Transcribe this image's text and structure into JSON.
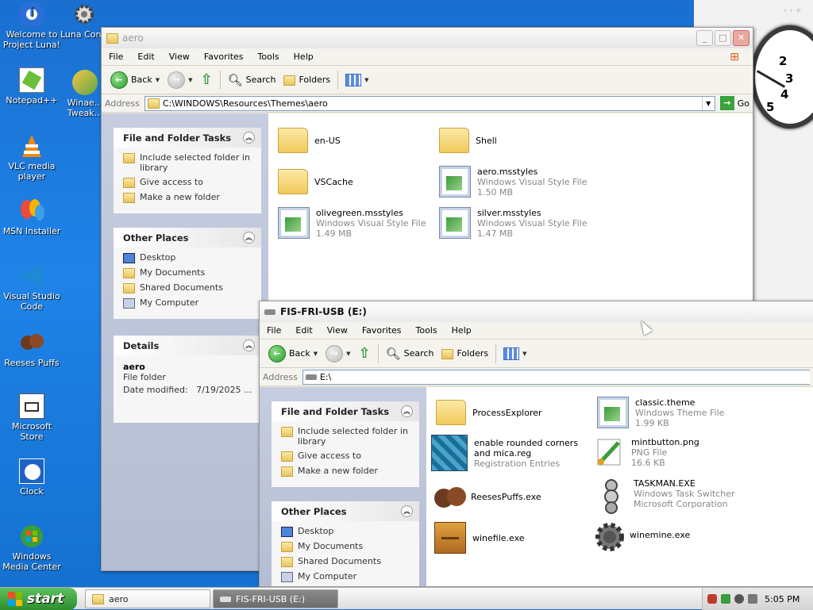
{
  "desktop": {
    "icons": [
      {
        "label": "Welcome to Project Luna!",
        "icon": "info-icon"
      },
      {
        "label": "Luna Configur...",
        "icon": "gears-icon"
      },
      {
        "label": "Notepad++",
        "icon": "notepad-icon"
      },
      {
        "label": "Winae... Tweak...",
        "icon": "winaero-icon"
      },
      {
        "label": "VLC media player",
        "icon": "vlc-icon"
      },
      {
        "label": "MSN Installer",
        "icon": "msn-icon"
      },
      {
        "label": "Visual Studio Code",
        "icon": "vscode-icon"
      },
      {
        "label": "Reeses Puffs",
        "icon": "cereal-icon"
      },
      {
        "label": "Microsoft Store",
        "icon": "store-icon"
      },
      {
        "label": "Clock",
        "icon": "clock-icon"
      },
      {
        "label": "Windows Media Center",
        "icon": "media-center-icon"
      }
    ]
  },
  "clock_gadget": {
    "numbers": [
      "2",
      "3",
      "4",
      "5"
    ]
  },
  "win1": {
    "title": "aero",
    "menu": [
      "File",
      "Edit",
      "View",
      "Favorites",
      "Tools",
      "Help"
    ],
    "toolbar": {
      "back": "Back",
      "search": "Search",
      "folders": "Folders"
    },
    "address_label": "Address",
    "address": "C:\\WINDOWS\\Resources\\Themes\\aero",
    "go": "Go",
    "tasks": {
      "title": "File and Folder Tasks",
      "items": [
        "Include selected folder in library",
        "Give access to",
        "Make a new folder"
      ]
    },
    "places": {
      "title": "Other Places",
      "items": [
        "Desktop",
        "My Documents",
        "Shared Documents",
        "My Computer"
      ]
    },
    "details": {
      "title": "Details",
      "name": "aero",
      "type": "File folder",
      "modified": "Date modified:   7/19/2025 ..."
    },
    "files": [
      {
        "name": "en-US",
        "type": "",
        "size": "",
        "icon": "folder-icon"
      },
      {
        "name": "Shell",
        "type": "",
        "size": "",
        "icon": "folder-icon"
      },
      {
        "name": "VSCache",
        "type": "",
        "size": "",
        "icon": "folder-icon"
      },
      {
        "name": "aero.msstyles",
        "type": "Windows Visual Style File",
        "size": "1.50 MB",
        "icon": "msstyles-icon"
      },
      {
        "name": "olivegreen.msstyles",
        "type": "Windows Visual Style File",
        "size": "1.49 MB",
        "icon": "msstyles-icon"
      },
      {
        "name": "silver.msstyles",
        "type": "Windows Visual Style File",
        "size": "1.47 MB",
        "icon": "msstyles-icon"
      }
    ]
  },
  "win2": {
    "title": "FIS-FRI-USB (E:)",
    "menu": [
      "File",
      "Edit",
      "View",
      "Favorites",
      "Tools",
      "Help"
    ],
    "toolbar": {
      "back": "Back",
      "search": "Search",
      "folders": "Folders"
    },
    "address_label": "Address",
    "address": "E:\\",
    "tasks": {
      "title": "File and Folder Tasks",
      "items": [
        "Include selected folder in library",
        "Give access to",
        "Make a new folder"
      ]
    },
    "places": {
      "title": "Other Places",
      "items": [
        "Desktop",
        "My Documents",
        "Shared Documents",
        "My Computer"
      ]
    },
    "files": [
      {
        "name": "ProcessExplorer",
        "type": "",
        "size": "",
        "icon": "folder-icon"
      },
      {
        "name": "classic.theme",
        "type": "Windows Theme File",
        "size": "1.99 KB",
        "icon": "theme-icon"
      },
      {
        "name": "enable rounded corners and mica.reg",
        "type": "Registration Entries",
        "size": "",
        "icon": "registry-icon"
      },
      {
        "name": "mintbutton.png",
        "type": "PNG File",
        "size": "16.6 KB",
        "icon": "paint-icon"
      },
      {
        "name": "ReesesPuffs.exe",
        "type": "",
        "size": "",
        "icon": "cereal-icon"
      },
      {
        "name": "TASKMAN.EXE",
        "type": "Windows Task Switcher",
        "size": "Microsoft Corporation",
        "icon": "taskman-icon"
      },
      {
        "name": "winefile.exe",
        "type": "",
        "size": "",
        "icon": "cabinet-icon"
      },
      {
        "name": "winemine.exe",
        "type": "",
        "size": "",
        "icon": "mine-icon"
      }
    ]
  },
  "taskbar": {
    "start": "start",
    "tasks": [
      "aero",
      "FIS-FRI-USB (E:)"
    ],
    "time": "5:05 PM"
  }
}
